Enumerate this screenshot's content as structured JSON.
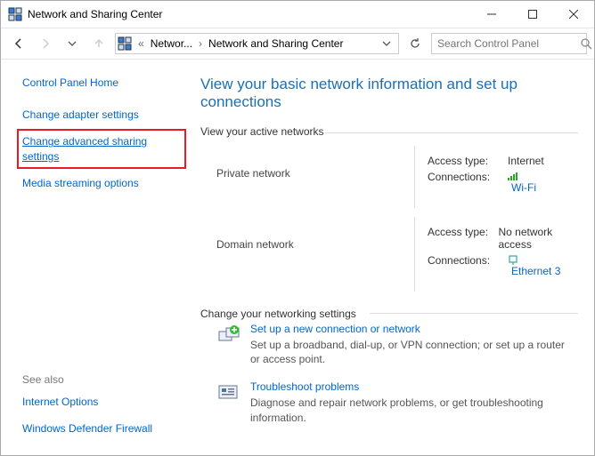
{
  "window": {
    "title": "Network and Sharing Center"
  },
  "breadcrumb": {
    "item1": "Networ...",
    "item2": "Network and Sharing Center"
  },
  "search": {
    "placeholder": "Search Control Panel"
  },
  "sidebar": {
    "home": "Control Panel Home",
    "adapter": "Change adapter settings",
    "advanced": "Change advanced sharing settings",
    "streaming": "Media streaming options",
    "seealso_label": "See also",
    "internet_options": "Internet Options",
    "firewall": "Windows Defender Firewall"
  },
  "main": {
    "heading": "View your basic network information and set up connections",
    "active_label": "View your active networks",
    "net1": {
      "name": "Private network",
      "access_label": "Access type:",
      "access_value": "Internet",
      "conn_label": "Connections:",
      "conn_link": "Wi-Fi"
    },
    "net2": {
      "name": "Domain network",
      "access_label": "Access type:",
      "access_value": "No network access",
      "conn_label": "Connections:",
      "conn_link": "Ethernet 3"
    },
    "change_label": "Change your networking settings",
    "task1": {
      "title": "Set up a new connection or network",
      "desc": "Set up a broadband, dial-up, or VPN connection; or set up a router or access point."
    },
    "task2": {
      "title": "Troubleshoot problems",
      "desc": "Diagnose and repair network problems, or get troubleshooting information."
    }
  }
}
